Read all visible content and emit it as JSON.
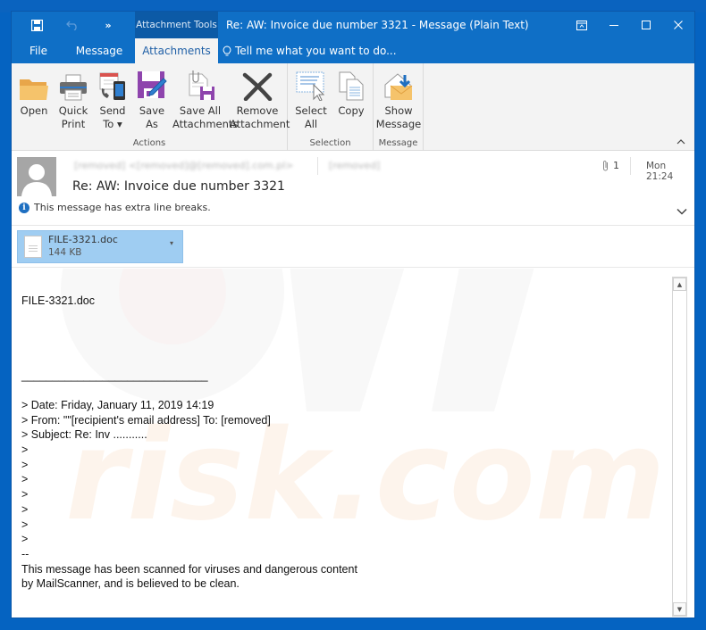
{
  "window": {
    "contextual_tab_group": "Attachment Tools",
    "title": "Re: AW: Invoice due number 3321 - Message (Plain Text)",
    "quick_access": [
      {
        "icon": "save-icon"
      },
      {
        "icon": "undo-icon"
      },
      {
        "icon": "more-commands-icon"
      }
    ],
    "controls": [
      {
        "icon": "ribbon-display-options-icon"
      },
      {
        "icon": "minimize-icon"
      },
      {
        "icon": "maximize-icon"
      },
      {
        "icon": "close-icon"
      }
    ]
  },
  "tabs": [
    {
      "label": "File",
      "active": false
    },
    {
      "label": "Message",
      "active": false
    },
    {
      "label": "Attachments",
      "active": true
    }
  ],
  "tell_me": {
    "placeholder": "Tell me what you want to do..."
  },
  "ribbon": {
    "groups": [
      {
        "label": "Actions",
        "buttons": [
          {
            "line1": "Open",
            "line2": "",
            "icon": "open-folder-icon"
          },
          {
            "line1": "Quick",
            "line2": "Print",
            "icon": "printer-icon"
          },
          {
            "line1": "Send",
            "line2": "To ▾",
            "icon": "send-to-icon"
          },
          {
            "line1": "Save",
            "line2": "As",
            "icon": "save-as-icon"
          },
          {
            "line1": "Save All",
            "line2": "Attachments",
            "icon": "save-all-attachments-icon"
          },
          {
            "line1": "Remove",
            "line2": "Attachment",
            "icon": "remove-attachment-icon"
          }
        ]
      },
      {
        "label": "Selection",
        "buttons": [
          {
            "line1": "Select",
            "line2": "All",
            "icon": "select-all-icon"
          },
          {
            "line1": "Copy",
            "line2": "",
            "icon": "copy-icon"
          }
        ]
      },
      {
        "label": "Message",
        "buttons": [
          {
            "line1": "Show",
            "line2": "Message",
            "icon": "show-message-icon"
          }
        ]
      }
    ]
  },
  "header": {
    "sender": "[removed] <[removed]@[removed].com.pl>",
    "to": "[removed]",
    "attachment_count": "1",
    "timestamp": "Mon 21:24",
    "subject": "Re: AW: Invoice due number 3321",
    "info_bar": "This message has extra line breaks."
  },
  "attachment": {
    "name": "FILE-3321.doc",
    "size": "144 KB"
  },
  "body": {
    "text": "FILE-3321.doc\n\n\n\n\n______________________________\n\n> Date: Friday, January 11, 2019 14:19\n> From: \"\"[recipient's email address] To: [removed]\n> Subject: Re: Inv ...........\n>\n>\n>\n>\n>\n>\n>\n--\nThis message has been scanned for viruses and dangerous content\nby MailScanner, and is believed to be clean."
  },
  "colors": {
    "title_bar": "#0f6fc6",
    "context_tab": "#0c5aa6",
    "ribbon_bg": "#f3f3f3",
    "attachment_selected": "#9fcdf2",
    "info_icon": "#1e6fc1"
  }
}
